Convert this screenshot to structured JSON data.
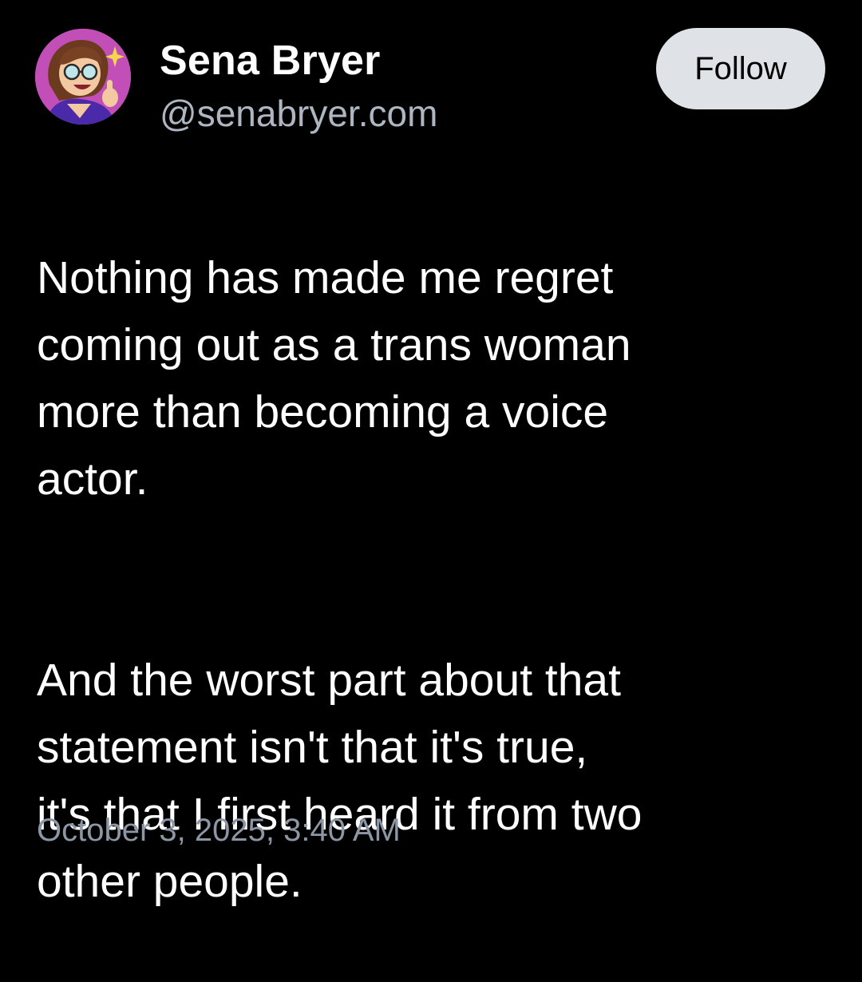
{
  "post": {
    "author": {
      "name": "Sena Bryer",
      "handle": "@senabryer.com",
      "avatar_icon": "avatar-illustration-icon"
    },
    "follow_label": "Follow",
    "text_paragraphs": [
      "Nothing has made me regret\ncoming out as a trans woman\nmore than becoming a voice\nactor.",
      "And the worst part about that\nstatement isn't that it's true,\nit's that I first heard it from two\nother people."
    ],
    "timestamp": "October 3, 2025, 3:40 AM"
  },
  "colors": {
    "background": "#000000",
    "text": "#ffffff",
    "secondary_text": "#aeb6c2",
    "timestamp_text": "#8c96a4",
    "follow_button_bg": "#dfe3e8",
    "avatar_bg": "#c24fb8"
  }
}
